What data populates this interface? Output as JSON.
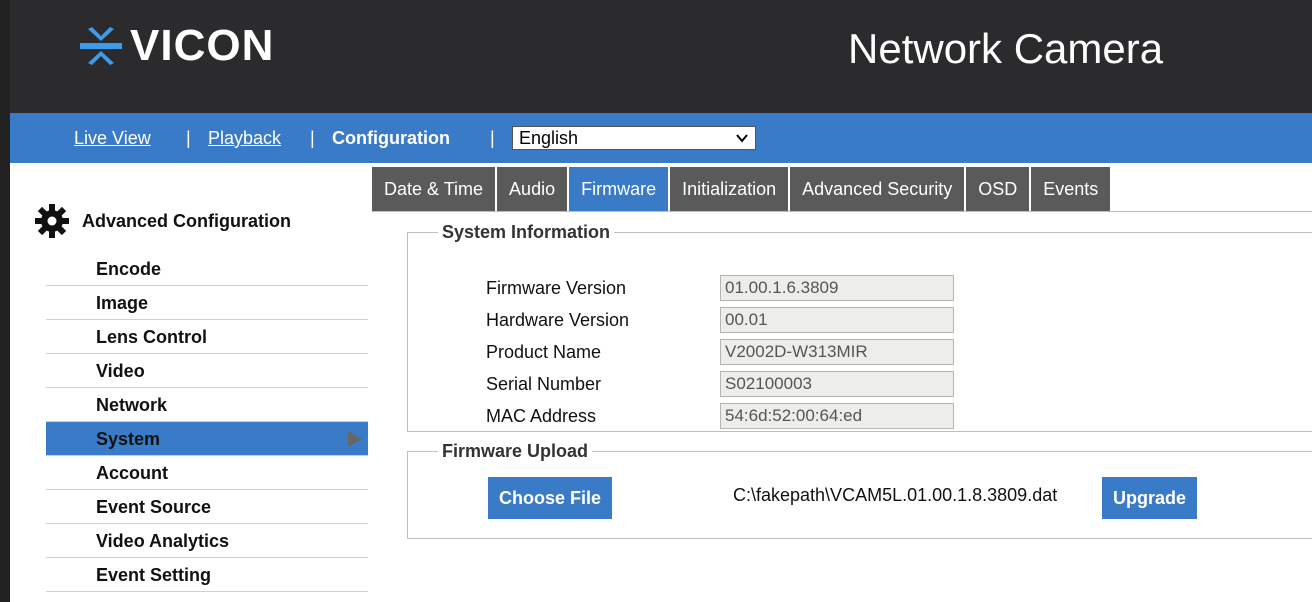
{
  "header": {
    "logo_text": "VICON",
    "product_title": "Network Camera"
  },
  "nav": {
    "live_view": "Live View",
    "playback": "Playback",
    "configuration": "Configuration",
    "separator": "|",
    "language": "English"
  },
  "sidebar": {
    "title": "Advanced Configuration",
    "items": [
      {
        "label": "Encode"
      },
      {
        "label": "Image"
      },
      {
        "label": "Lens Control"
      },
      {
        "label": "Video"
      },
      {
        "label": "Network"
      },
      {
        "label": "System"
      },
      {
        "label": "Account"
      },
      {
        "label": "Event Source"
      },
      {
        "label": "Video Analytics"
      },
      {
        "label": "Event Setting"
      }
    ],
    "active_index": 5
  },
  "tabs": [
    {
      "label": "Date & Time"
    },
    {
      "label": "Audio"
    },
    {
      "label": "Firmware"
    },
    {
      "label": "Initialization"
    },
    {
      "label": "Advanced Security"
    },
    {
      "label": "OSD"
    },
    {
      "label": "Events"
    }
  ],
  "active_tab": 2,
  "system_info": {
    "legend": "System Information",
    "rows": [
      {
        "label": "Firmware Version",
        "value": "01.00.1.6.3809"
      },
      {
        "label": "Hardware Version",
        "value": "00.01"
      },
      {
        "label": "Product Name",
        "value": "V2002D-W313MIR"
      },
      {
        "label": "Serial Number",
        "value": "S02100003"
      },
      {
        "label": "MAC Address",
        "value": "54:6d:52:00:64:ed"
      }
    ]
  },
  "firmware_upload": {
    "legend": "Firmware Upload",
    "choose_label": "Choose File",
    "file_path": "C:\\fakepath\\VCAM5L.01.00.1.8.3809.dat",
    "upgrade_label": "Upgrade"
  },
  "colors": {
    "header_bg": "#2b2b2d",
    "accent_blue": "#3a7bc8",
    "tab_gray": "#5a5a5a",
    "logo_blue": "#3d9be9"
  }
}
